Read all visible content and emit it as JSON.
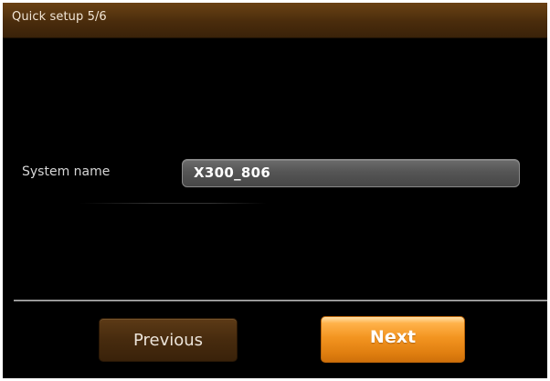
{
  "window": {
    "title": "Quick setup 5/6"
  },
  "form": {
    "system_name_label": "System name",
    "system_name_value": "X300_806"
  },
  "footer": {
    "previous_label": "Previous",
    "next_label": "Next"
  },
  "colors": {
    "title_bar": "#4a2c0c",
    "background": "#000000",
    "input_bg": "#555555",
    "next_button": "#f39521",
    "previous_button": "#472b0e"
  }
}
